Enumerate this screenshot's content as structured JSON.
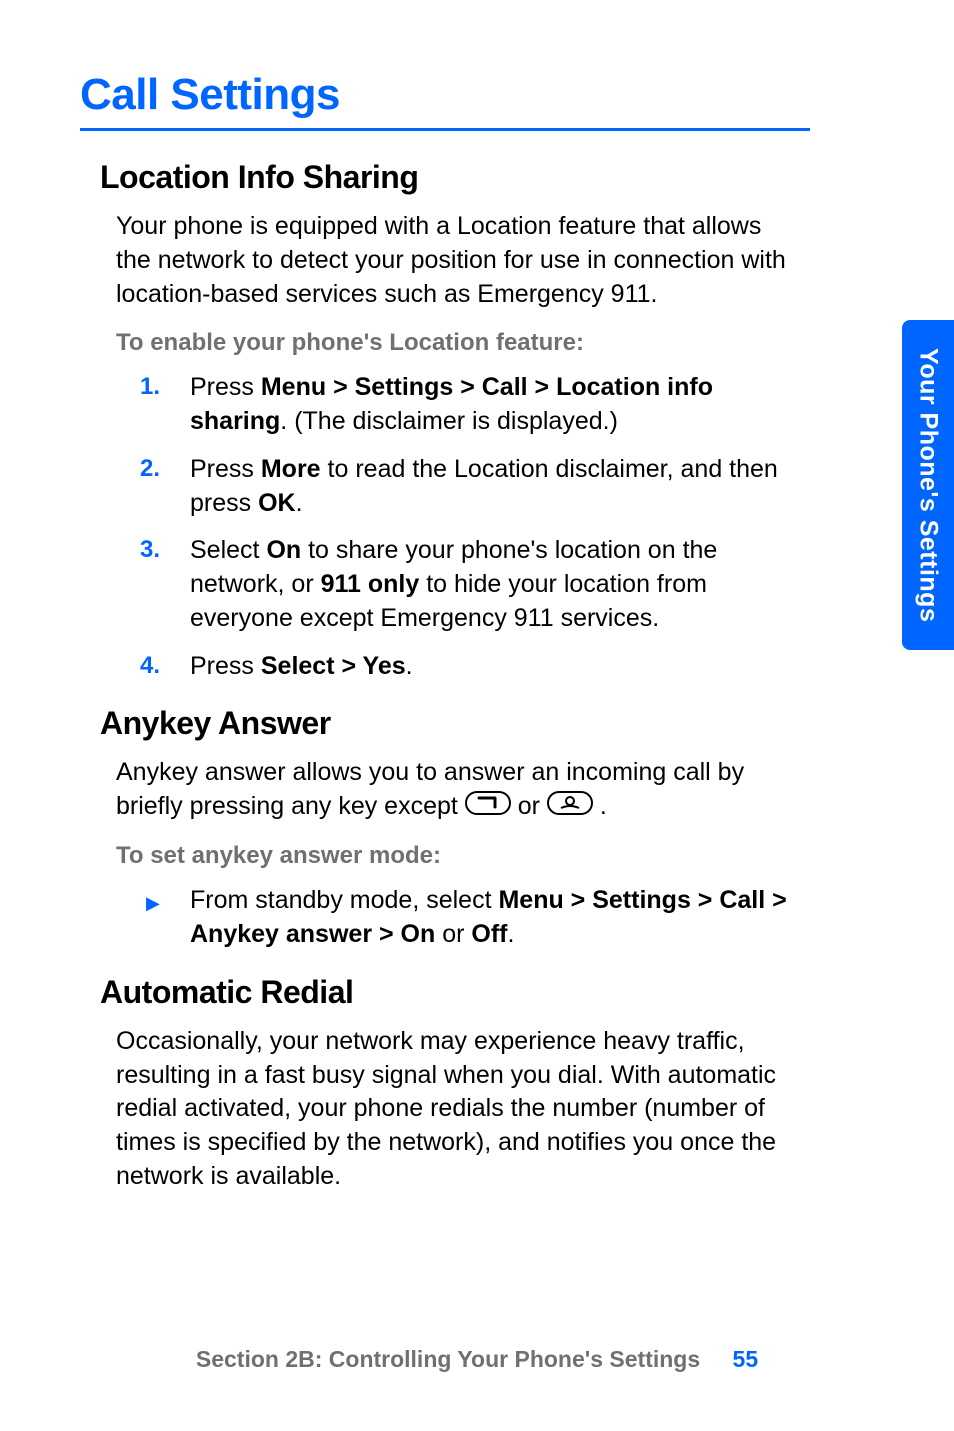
{
  "main_heading": "Call Settings",
  "side_tab": "Your Phone's Settings",
  "sections": {
    "location": {
      "heading": "Location Info Sharing",
      "intro": "Your phone is equipped with a Location feature that allows the network to detect your position for use in connection with location-based services such as Emergency 911.",
      "instruction_label": "To enable your phone's Location feature:",
      "steps": [
        {
          "num": "1.",
          "pre": "Press ",
          "bold1": "Menu > Settings > Call > Location info sharing",
          "post1": ". (The  disclaimer is displayed.)"
        },
        {
          "num": "2.",
          "pre": "Press ",
          "bold1": "More",
          "mid1": " to read the Location disclaimer, and then press ",
          "bold2": "OK",
          "post2": "."
        },
        {
          "num": "3.",
          "pre": "Select ",
          "bold1": "On",
          "mid1": " to share your phone's location on the network, or ",
          "bold2": "911 only",
          "post2": " to hide your location from everyone except Emergency 911 services."
        },
        {
          "num": "4.",
          "pre": "Press ",
          "bold1": "Select > Yes",
          "post1": "."
        }
      ]
    },
    "anykey": {
      "heading": "Anykey Answer",
      "intro_pre": "Anykey answer allows you to answer an incoming call by briefly pressing any key except ",
      "intro_mid": " or ",
      "intro_post": ".",
      "instruction_label": "To set anykey answer mode:",
      "bullet_pre": "From standby mode, select ",
      "bullet_bold": "Menu > Settings > Call > Anykey answer > On",
      "bullet_mid": " or ",
      "bullet_bold2": "Off",
      "bullet_post": "."
    },
    "redial": {
      "heading": "Automatic Redial",
      "intro": "Occasionally, your network may experience heavy traffic, resulting in a fast busy signal when you dial. With automatic redial activated, your phone redials the number (number of times is specified by the network), and notifies you once the network is available."
    }
  },
  "footer": {
    "section": "Section 2B: Controlling Your Phone's Settings",
    "page": "55"
  }
}
